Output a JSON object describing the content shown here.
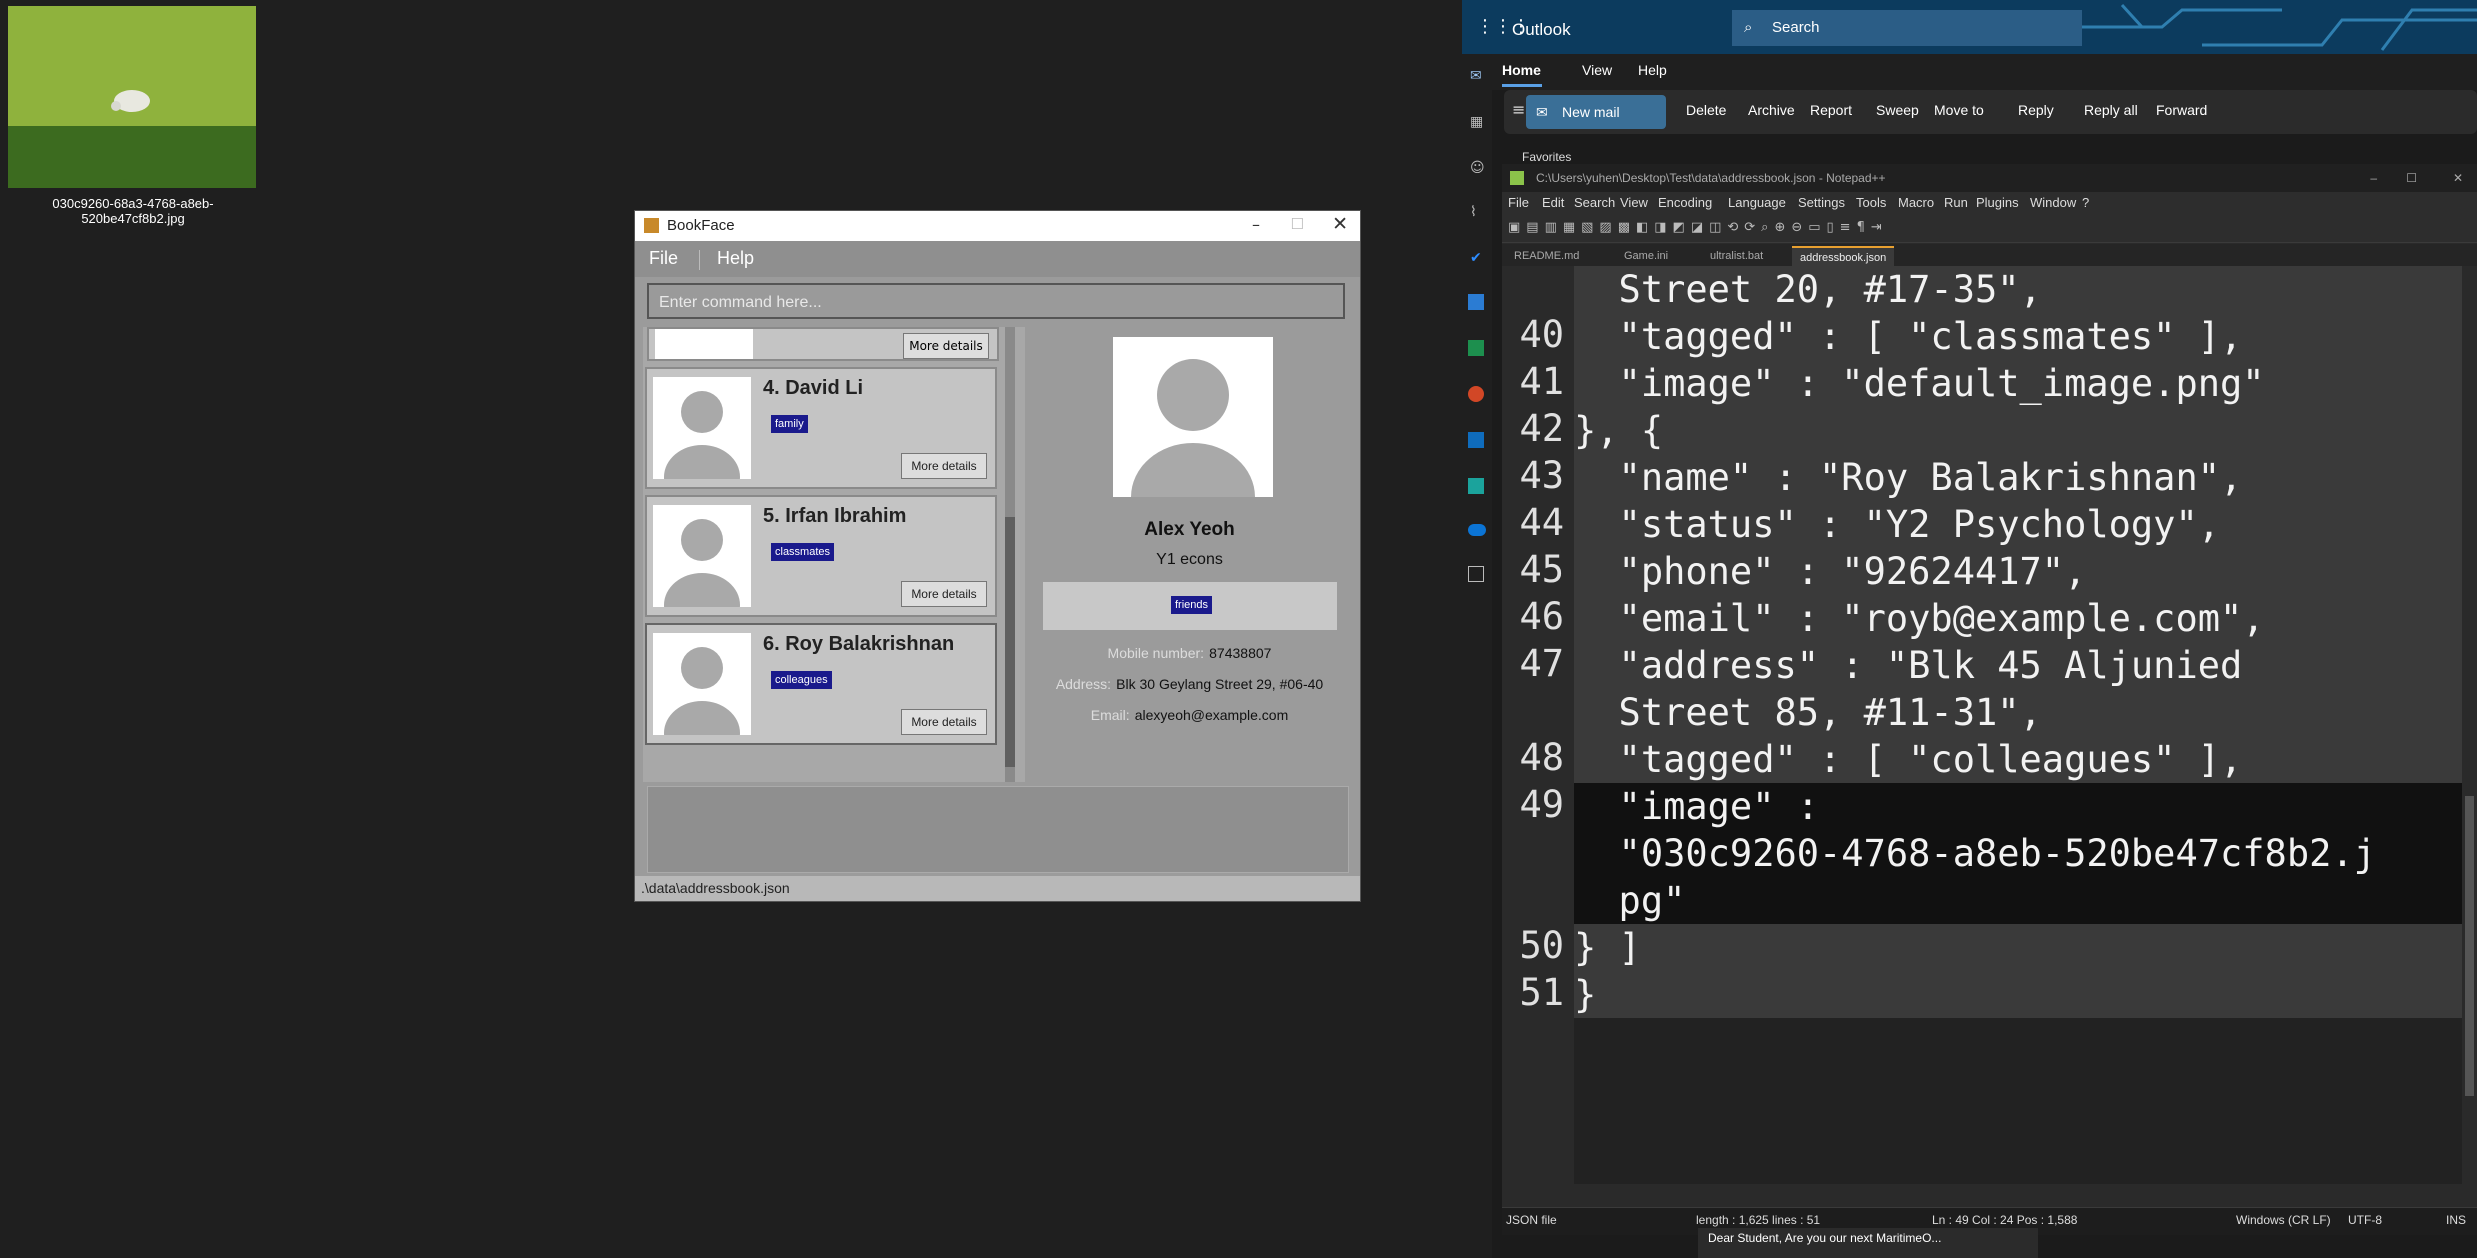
{
  "desktop": {
    "icon_label": "030c9260-68a3-4768-a8eb-520be47cf8b2.jpg"
  },
  "bookface": {
    "title": "BookFace",
    "menu": [
      "File",
      "Help"
    ],
    "command_placeholder": "Enter command here...",
    "more_label": "More details",
    "cards": [
      {
        "name": "4. David Li",
        "tag": "family"
      },
      {
        "name": "5. Irfan Ibrahim",
        "tag": "classmates"
      },
      {
        "name": "6. Roy Balakrishnan",
        "tag": "colleagues"
      }
    ],
    "detail": {
      "name": "Alex Yeoh",
      "status": "Y1 econs",
      "tag": "friends",
      "mobile_label": "Mobile number:",
      "mobile": "87438807",
      "address_label": "Address:",
      "address": "Blk 30 Geylang Street 29, #06-40",
      "email_label": "Email:",
      "email": "alexyeoh@example.com"
    },
    "status_path": ".\\data\\addressbook.json"
  },
  "outlook": {
    "brand": "Outlook",
    "search": "Search",
    "tabs": [
      "Home",
      "View",
      "Help"
    ],
    "ribbon": {
      "new_mail": "New mail",
      "delete": "Delete",
      "archive": "Archive",
      "report": "Report",
      "sweep": "Sweep",
      "move_to": "Move to",
      "reply": "Reply",
      "reply_all": "Reply all",
      "forward": "Forward"
    },
    "favorites": "Favorites",
    "notification": "Dear Student, Are you our next MaritimeO..."
  },
  "notepad": {
    "title": "C:\\Users\\yuhen\\Desktop\\Test\\data\\addressbook.json - Notepad++",
    "menu": [
      "File",
      "Edit",
      "Search",
      "View",
      "Encoding",
      "Language",
      "Settings",
      "Tools",
      "Macro",
      "Run",
      "Plugins",
      "Window",
      "?"
    ],
    "tabs": [
      "README.md",
      "Game.ini",
      "ultralist.bat",
      "addressbook.json"
    ],
    "gutter": [
      "",
      "40",
      "41",
      "42",
      "43",
      "44",
      "45",
      "46",
      "47",
      "",
      "48",
      "49",
      "",
      "",
      "50",
      "51"
    ],
    "code": [
      "  Street 20, #17-35\",",
      "  \"tagged\" : [ \"classmates\" ],",
      "  \"image\" : \"default_image.png\"",
      "}, {",
      "  \"name\" : \"Roy Balakrishnan\",",
      "  \"status\" : \"Y2 Psychology\",",
      "  \"phone\" : \"92624417\",",
      "  \"email\" : \"royb@example.com\",",
      "  \"address\" : \"Blk 45 Aljunied",
      "  Street 85, #11-31\",",
      "  \"tagged\" : [ \"colleagues\" ],",
      "  \"image\" :",
      "  \"030c9260-4768-a8eb-520be47cf8b2.j",
      "  pg\"",
      "} ]",
      "}"
    ],
    "status": {
      "type": "JSON file",
      "length": "length : 1,625   lines : 51",
      "pos": "Ln : 49   Col : 24   Pos : 1,588",
      "eol": "Windows (CR LF)",
      "enc": "UTF-8",
      "ins": "INS"
    }
  }
}
